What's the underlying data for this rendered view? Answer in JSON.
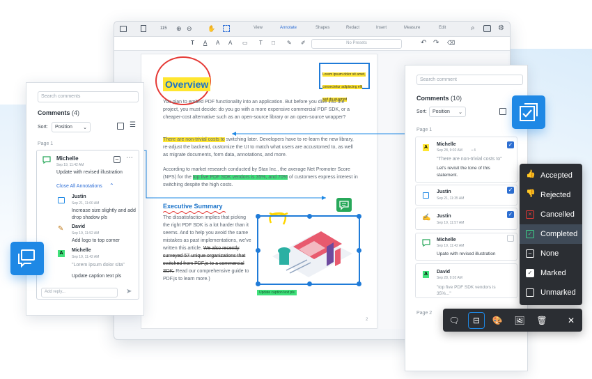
{
  "toolbar": {
    "zoom": "115",
    "tabs": [
      "View",
      "Annotate",
      "Shapes",
      "Redact",
      "Insert",
      "Measure",
      "Edit"
    ],
    "active_tab": "Annotate",
    "presets_placeholder": "No Presets"
  },
  "doc": {
    "title": "Overview",
    "para1": "You plan to embed PDF functionality into an application. But before you dive into the project, you must decide: do you go with a more expensive commercial PDF SDK, or a cheaper-cost alternative such as an open-source library or an open-source wrapper?",
    "para2_hl": "There are non-trivial costs to",
    "para2_rest": "switching later. Developers have to re-learn the new library, re-adjust the backend, customize the UI to match what users are accustomed to, as well as migrate documents, form data, annotations, and more.",
    "para3_a": "According to market research conducted by Stax Inc., the average Net Promoter Score (NPS) for the",
    "para3_hl": "top five PDF SDK vendors is 35%, and 70%",
    "para3_b": "of customers express interest in switching despite the high costs.",
    "exec_title": "Executive Summary",
    "exec_text": "The dissatisfaction implies that picking the right PDF SDK is a lot harder than it seems. And to help you avoid the same mistakes as past implementations, we've written this article.",
    "exec_strike": "We also recently surveyed 57 unique organizations that switched from PDF.js to a commercial SDK.",
    "exec_tail": "Read our comprehensive guide to PDF.js to learn more.)",
    "mini_ann": "Lorem ipsum dolor sit amet, consectetur adipiscing elit sed do eiusmod",
    "img_caption": "Update caption text pls",
    "page_number": "2"
  },
  "left_panel": {
    "search_placeholder": "Search comments",
    "comments_label": "Comments",
    "comments_count": "(4)",
    "sort_label": "Sort:",
    "sort_value": "Position",
    "page_label": "Page 1",
    "michelle": {
      "name": "Michelle",
      "date": "Sep 19, 11:42 AM",
      "text": "Update with revised illustration"
    },
    "close_all": "Close All Annotations",
    "justin": {
      "name": "Justin",
      "date": "Sep 21, 11:00 AM",
      "text": "Increase size slightly and add drop shadow pls"
    },
    "david": {
      "name": "David",
      "date": "Sep 19, 11:52 AM",
      "text": "Add logo to top corner"
    },
    "michelle2": {
      "name": "Michelle",
      "date": "Sep 19, 11:42 AM",
      "quote": "\"Lorem ipsum dolor sita\"",
      "text": "Update caption text pls"
    },
    "reply_placeholder": "Add reply..."
  },
  "right_panel": {
    "search_placeholder": "Search comment",
    "comments_label": "Comments",
    "comments_count": "(10)",
    "sort_label": "Sort:",
    "sort_value": "Position",
    "page_label": "Page 1",
    "c1": {
      "name": "Michelle",
      "date": "Sep 28, 9:02 AM",
      "reply_count": "4",
      "quote": "\"There are non-trivial costs to\"",
      "text": "Let's revisit the tone of this statement."
    },
    "c2": {
      "name": "Justin",
      "date": "Sep 21, 11:35 AM"
    },
    "c3": {
      "name": "Justin",
      "date": "Sep 19, 11:57 AM"
    },
    "c4": {
      "name": "Michelle",
      "date": "Sep 19, 11:42 AM",
      "text": "Upate with revised illustration"
    },
    "c5": {
      "name": "David",
      "date": "Sep 28, 9:02 AM",
      "quote": "\"top five PDF SDK vendors is 35%...\""
    },
    "page2_label": "Page 2"
  },
  "status_menu": {
    "items": [
      "Accepted",
      "Rejected",
      "Cancelled",
      "Completed",
      "None",
      "Marked",
      "Unmarked"
    ],
    "selected": "Completed"
  },
  "colors": {
    "accent": "#1e88e5",
    "highlight_yellow": "#ffe630",
    "highlight_green": "#3fe07a",
    "menu_bg": "#2b2e33"
  }
}
